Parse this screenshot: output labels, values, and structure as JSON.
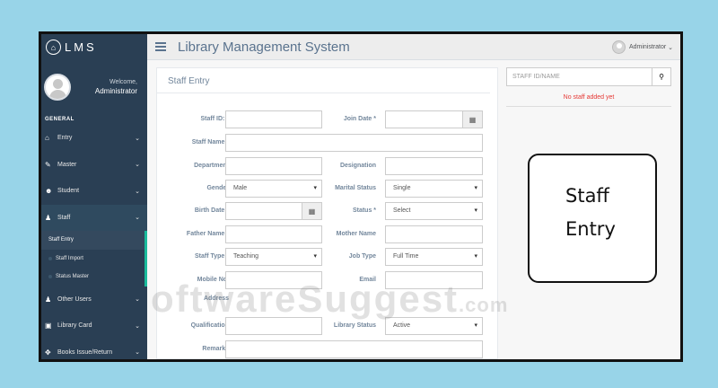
{
  "brand": {
    "name": "LMS"
  },
  "profile": {
    "welcome": "Welcome,",
    "name": "Administrator"
  },
  "sidebar": {
    "section": "GENERAL",
    "items": [
      {
        "label": "Entry",
        "icon": "home-icon"
      },
      {
        "label": "Master",
        "icon": "edit-icon"
      },
      {
        "label": "Student",
        "icon": "users-icon"
      },
      {
        "label": "Staff",
        "icon": "user-icon",
        "submenu": [
          "Staff Entry",
          "Staff Import",
          "Status Master"
        ]
      },
      {
        "label": "Other Users",
        "icon": "user-icon"
      },
      {
        "label": "Library Card",
        "icon": "card-icon"
      },
      {
        "label": "Books Issue/Return",
        "icon": "arrows-icon"
      }
    ]
  },
  "topbar": {
    "title": "Library Management System",
    "user": "Administrator"
  },
  "form": {
    "title": "Staff Entry",
    "staff_id_label": "Staff ID: *",
    "join_date_label": "Join Date *",
    "staff_name_label": "Staff Name *",
    "department_label": "Department",
    "designation_label": "Designation",
    "gender_label": "Gender",
    "gender_value": "Male",
    "marital_label": "Marital Status",
    "marital_value": "Single",
    "birth_label": "Birth Date *",
    "status_label": "Status *",
    "status_value": "Select",
    "father_label": "Father Name *",
    "mother_label": "Mother Name",
    "stafftype_label": "Staff Type *",
    "stafftype_value": "Teaching",
    "jobtype_label": "Job Type",
    "jobtype_value": "Full Time",
    "mobile_label": "Mobile No.",
    "email_label": "Email",
    "address_label": "Address",
    "qualification_label": "Qualification",
    "libstatus_label": "Library Status",
    "libstatus_value": "Active",
    "remarks_label": "Remarks"
  },
  "side": {
    "search_placeholder": "STAFF ID/NAME",
    "empty_message": "No staff added yet"
  },
  "callout": {
    "line1": "Staff",
    "line2": "Entry"
  },
  "watermark": {
    "main": "oftwareSuggest",
    "suffix": ".com"
  },
  "colors": {
    "sidebar": "#2a3f54",
    "accent": "#1abb9c",
    "error": "#e53935"
  }
}
